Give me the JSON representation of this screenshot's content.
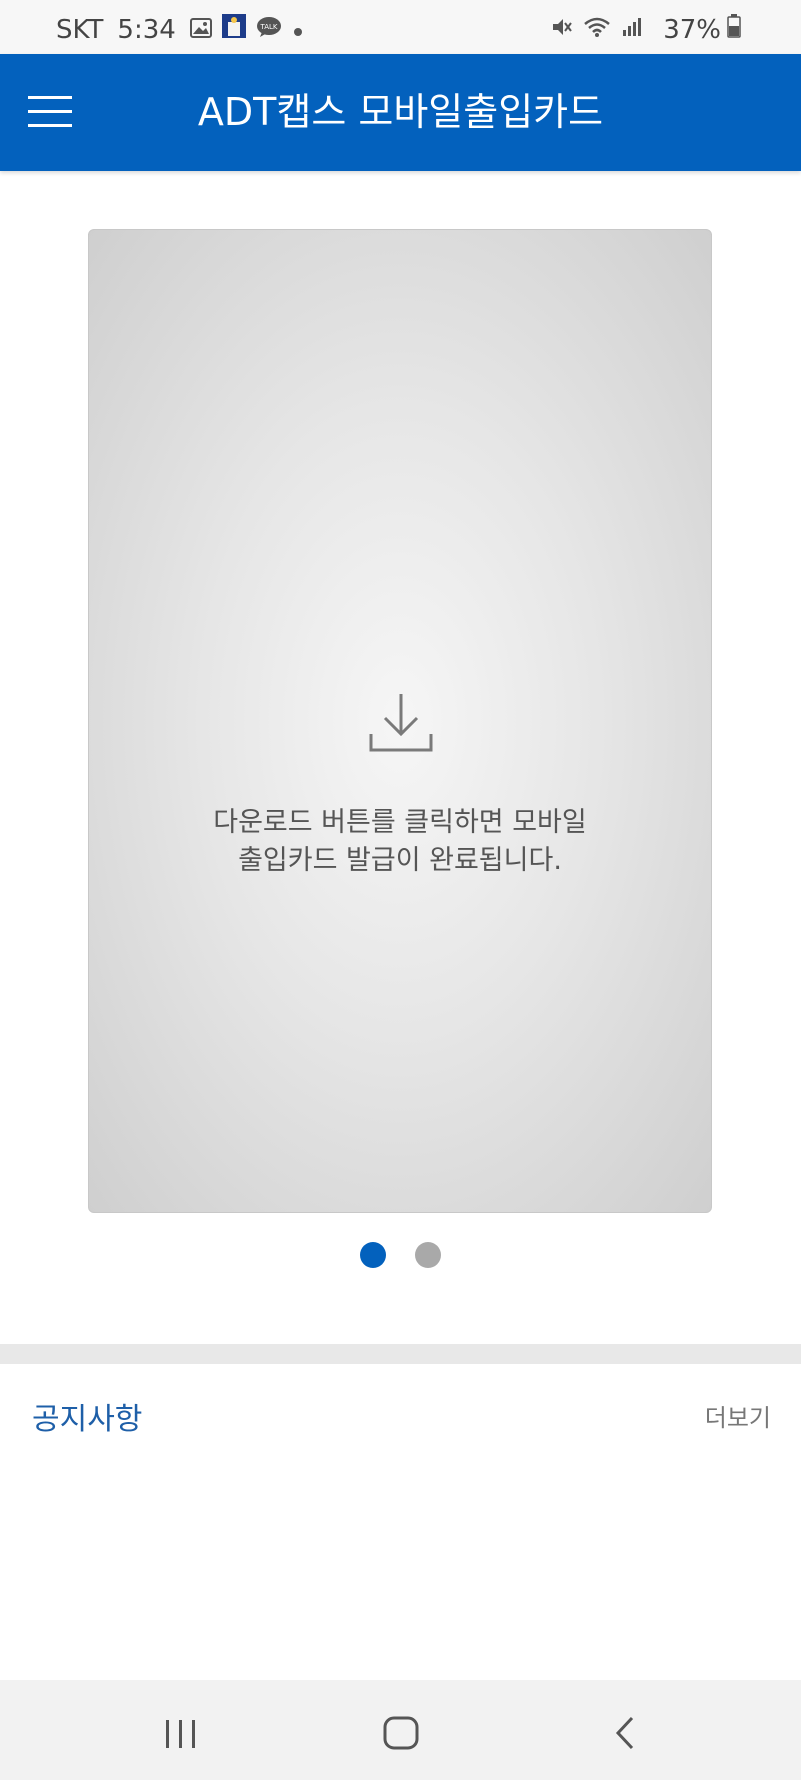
{
  "status_bar": {
    "carrier": "SKT",
    "time": "5:34",
    "battery_percent": "37%",
    "icons": [
      "gallery-icon",
      "app-notification-icon",
      "talk-icon",
      "dot-icon",
      "mute-icon",
      "wifi-icon",
      "signal-icon",
      "battery-icon"
    ]
  },
  "app_bar": {
    "title": "ADT캡스 모바일출입카드",
    "menu_icon": "hamburger-menu-icon"
  },
  "card": {
    "message_line1": "다운로드 버튼를 클릭하면 모바일",
    "message_line2": "출입카드 발급이 완료됩니다.",
    "icon": "download-icon"
  },
  "pager": {
    "total": 2,
    "active_index": 0
  },
  "notice": {
    "title": "공지사항",
    "more_label": "더보기"
  },
  "nav_bar": {
    "buttons": [
      "recent-apps-icon",
      "home-icon",
      "back-icon"
    ]
  },
  "colors": {
    "primary": "#0361bd",
    "notice_title": "#1e5fa8",
    "inactive_dot": "#a9a9a9"
  }
}
